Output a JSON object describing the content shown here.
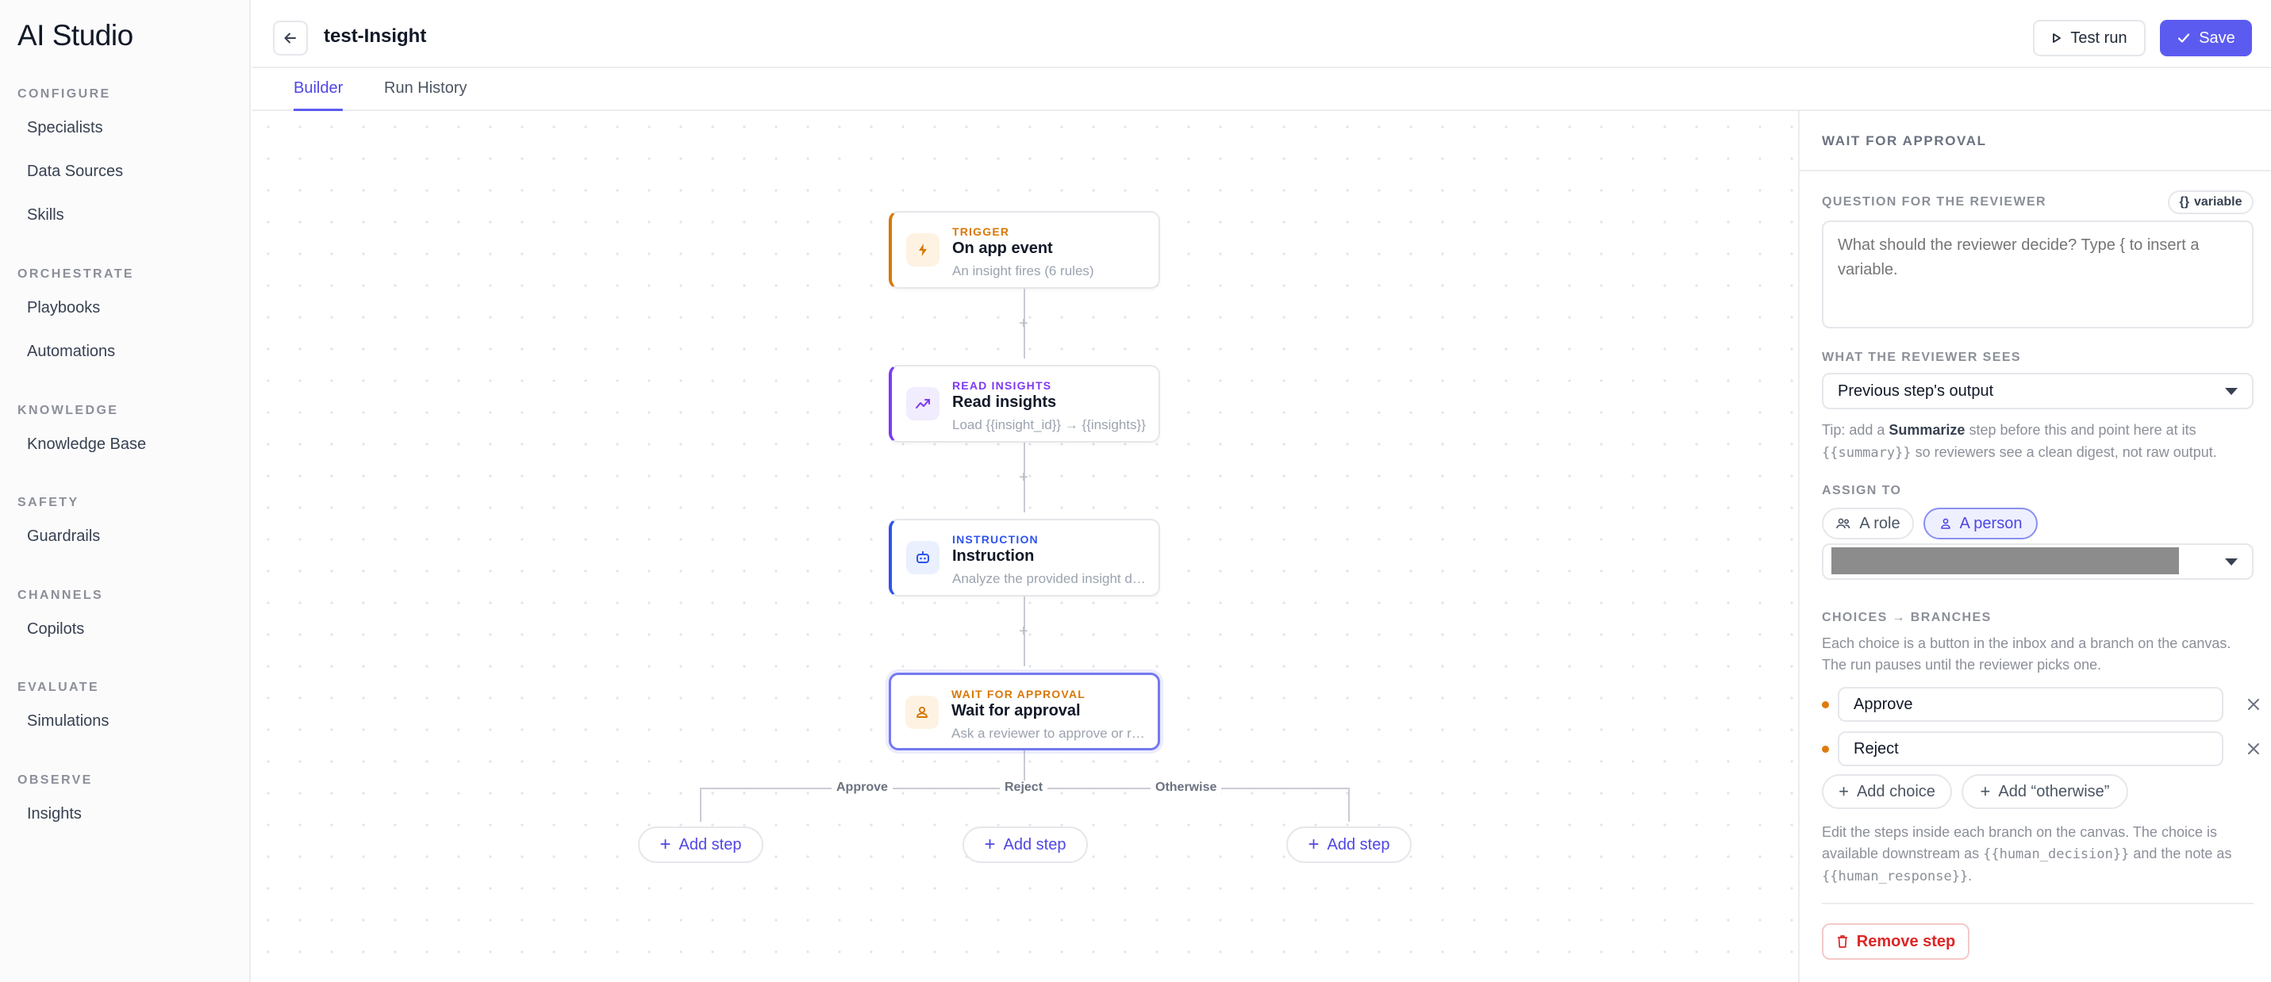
{
  "app": {
    "brand": "AI Studio"
  },
  "sidebar": {
    "sections": [
      {
        "heading": "CONFIGURE",
        "items": [
          "Specialists",
          "Data Sources",
          "Skills"
        ]
      },
      {
        "heading": "ORCHESTRATE",
        "items": [
          "Playbooks",
          "Automations"
        ]
      },
      {
        "heading": "KNOWLEDGE",
        "items": [
          "Knowledge Base"
        ]
      },
      {
        "heading": "SAFETY",
        "items": [
          "Guardrails"
        ]
      },
      {
        "heading": "CHANNELS",
        "items": [
          "Copilots"
        ]
      },
      {
        "heading": "EVALUATE",
        "items": [
          "Simulations"
        ]
      },
      {
        "heading": "OBSERVE",
        "items": [
          "Insights"
        ]
      }
    ]
  },
  "header": {
    "title": "test-Insight",
    "test_run_label": "Test run",
    "save_label": "Save"
  },
  "tabs": [
    {
      "label": "Builder",
      "active": true
    },
    {
      "label": "Run History",
      "active": false
    }
  ],
  "workflow": {
    "nodes": [
      {
        "kind": "TRIGGER",
        "name": "On app event",
        "desc": "An insight fires (6 rules)",
        "color": "#d97706",
        "icon": "bolt-icon"
      },
      {
        "kind": "READ INSIGHTS",
        "name": "Read insights",
        "desc": "Load {{insight_id}} → {{insights}}",
        "color": "#7e3af2",
        "icon": "trend-icon"
      },
      {
        "kind": "INSTRUCTION",
        "name": "Instruction",
        "desc": "Analyze the provided insight data",
        "color": "#2f54eb",
        "icon": "robot-icon"
      },
      {
        "kind": "WAIT FOR APPROVAL",
        "name": "Wait for approval",
        "desc": "Ask a reviewer to approve or reject",
        "color": "#d97706",
        "icon": "person-icon"
      }
    ],
    "branches": [
      {
        "label": "Approve",
        "add_step": "Add step"
      },
      {
        "label": "Reject",
        "add_step": "Add step"
      },
      {
        "label": "Otherwise",
        "add_step": "Add step"
      }
    ]
  },
  "panel": {
    "heading": "WAIT FOR APPROVAL",
    "question_label": "QUESTION FOR THE REVIEWER",
    "variable_chip": "variable",
    "question_placeholder": "What should the reviewer decide? Type { to insert a variable.",
    "sees_label": "WHAT THE REVIEWER SEES",
    "sees_value": "Previous step's output",
    "tip_prefix": "Tip: add a ",
    "tip_bold": "Summarize",
    "tip_mid": " step before this and point here at its ",
    "tip_code": "{{summary}}",
    "tip_suffix": " so reviewers see a clean digest, not raw output.",
    "assign_label": "ASSIGN TO",
    "assign_role": "A role",
    "assign_person": "A person",
    "choices_label": "CHOICES → BRANCHES",
    "choices_help": "Each choice is a button in the inbox and a branch on the canvas. The run pauses until the reviewer picks one.",
    "choices": [
      "Approve",
      "Reject"
    ],
    "add_choice": "Add choice",
    "add_otherwise": "Add “otherwise”",
    "footer_a": "Edit the steps inside each branch on the canvas. The choice is available downstream as ",
    "footer_code1": "{{human_decision}}",
    "footer_b": " and the note as ",
    "footer_code2": "{{human_response}}",
    "footer_c": ".",
    "remove_label": "Remove step",
    "colors": {
      "accent": "#5b5bf0",
      "danger": "#dc2626",
      "choice_dot": "#e07a10"
    }
  }
}
